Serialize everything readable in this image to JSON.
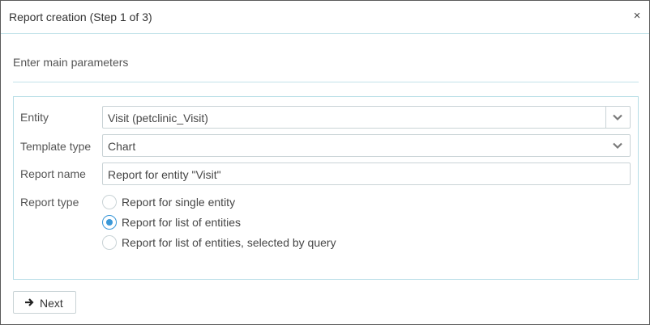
{
  "dialog": {
    "title": "Report creation (Step 1 of 3)",
    "close_glyph": "×",
    "subtitle": "Enter main parameters"
  },
  "form": {
    "entity": {
      "label": "Entity",
      "value": "Visit (petclinic_Visit)"
    },
    "template_type": {
      "label": "Template type",
      "value": "Chart"
    },
    "report_name": {
      "label": "Report name",
      "value": "Report for entity \"Visit\""
    },
    "report_type": {
      "label": "Report type",
      "options": [
        {
          "label": "Report for single entity",
          "checked": false
        },
        {
          "label": "Report for list of entities",
          "checked": true
        },
        {
          "label": "Report for list of entities, selected by query",
          "checked": false
        }
      ]
    }
  },
  "footer": {
    "next_label": "Next",
    "next_icon": "arrow-right-icon"
  },
  "colors": {
    "accent": "#3a98d8",
    "border": "#c9d3d6",
    "separator": "#c3e3ea"
  }
}
